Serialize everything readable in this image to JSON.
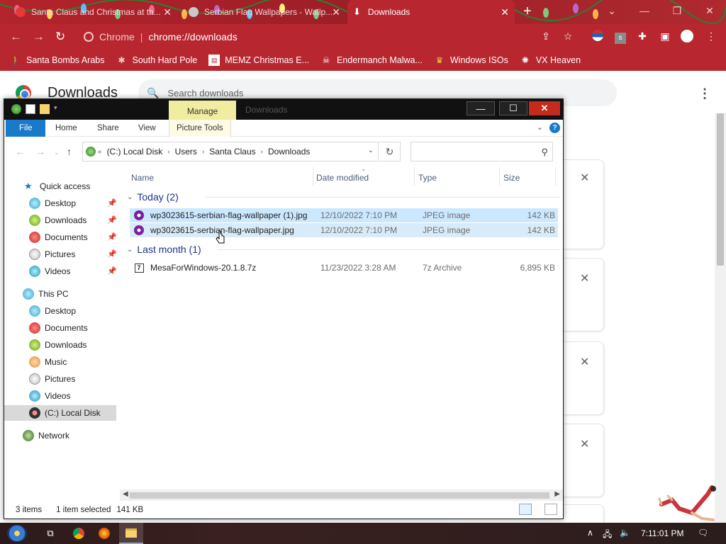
{
  "chrome": {
    "tabs": [
      {
        "title": "Santa Claus and Christmas at th...",
        "active": false
      },
      {
        "title": "Serbian Flag Wallpapers - Wallp...",
        "active": false
      },
      {
        "title": "Downloads",
        "active": true
      }
    ],
    "omnibox": {
      "scheme_label": "Chrome",
      "url": "chrome://downloads"
    },
    "bookmarks": [
      {
        "label": "Santa Bombs Arabs",
        "icon": "person-icon"
      },
      {
        "label": "South Hard Pole",
        "icon": "snowflake-icon"
      },
      {
        "label": "MEMZ Christmas E...",
        "icon": "page-icon"
      },
      {
        "label": "Endermanch Malwa...",
        "icon": "skull-icon"
      },
      {
        "label": "Windows ISOs",
        "icon": "trophy-icon"
      },
      {
        "label": "VX Heaven",
        "icon": "bug-icon"
      }
    ],
    "downloads_page": {
      "title": "Downloads",
      "search_placeholder": "Search downloads"
    }
  },
  "explorer": {
    "title": "Downloads",
    "contextual_tab": "Manage",
    "ribbon_tabs": [
      "File",
      "Home",
      "Share",
      "View",
      "Picture Tools"
    ],
    "breadcrumb": [
      "(C:) Local Disk",
      "Users",
      "Santa Claus",
      "Downloads"
    ],
    "columns": {
      "name": "Name",
      "date": "Date modified",
      "type": "Type",
      "size": "Size"
    },
    "nav": {
      "quick_access": "Quick access",
      "quick_items": [
        "Desktop",
        "Downloads",
        "Documents",
        "Pictures",
        "Videos"
      ],
      "this_pc": "This PC",
      "pc_items": [
        "Desktop",
        "Documents",
        "Downloads",
        "Music",
        "Pictures",
        "Videos",
        "(C:) Local Disk"
      ],
      "network": "Network"
    },
    "groups": [
      {
        "label": "Today (2)",
        "files": [
          {
            "name": "wp3023615-serbian-flag-wallpaper (1).jpg",
            "date": "12/10/2022 7:10 PM",
            "type": "JPEG image",
            "size": "142 KB"
          },
          {
            "name": "wp3023615-serbian-flag-wallpaper.jpg",
            "date": "12/10/2022 7:10 PM",
            "type": "JPEG image",
            "size": "142 KB"
          }
        ]
      },
      {
        "label": "Last month (1)",
        "files": [
          {
            "name": "MesaForWindows-20.1.8.7z",
            "date": "11/23/2022 3:28 AM",
            "type": "7z Archive",
            "size": "6,895 KB"
          }
        ]
      }
    ],
    "status": {
      "count": "3 items",
      "selected": "1 item selected",
      "size": "141 KB"
    }
  },
  "taskbar": {
    "clock": "7:11:01 PM"
  },
  "colors": {
    "chrome_red": "#b8272f",
    "file_tab_blue": "#1979ca",
    "manage_yellow": "#f0eca0",
    "selection": "#cce8ff"
  }
}
